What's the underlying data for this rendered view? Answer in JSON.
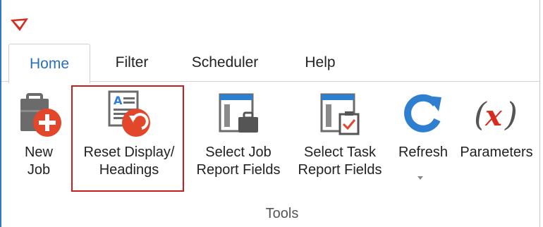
{
  "app": {
    "logo_icon": "app-logo-icon",
    "accent_color": "#c81e1e"
  },
  "tabs": [
    {
      "label": "Home",
      "active": true
    },
    {
      "label": "Filter",
      "active": false
    },
    {
      "label": "Scheduler",
      "active": false
    },
    {
      "label": "Help",
      "active": false
    }
  ],
  "ribbon": {
    "group_label": "Tools",
    "buttons": [
      {
        "line1": "New",
        "line2": "Job",
        "icon": "new-job-icon"
      },
      {
        "line1": "Reset Display/",
        "line2": "Headings",
        "icon": "reset-display-icon",
        "highlighted": true
      },
      {
        "line1": "Select Job",
        "line2": "Report Fields",
        "icon": "select-job-report-fields-icon"
      },
      {
        "line1": "Select Task",
        "line2": "Report Fields",
        "icon": "select-task-report-fields-icon"
      },
      {
        "line1": "Refresh",
        "line2": "",
        "icon": "refresh-icon",
        "has_dropdown": true
      },
      {
        "line1": "Parameters",
        "line2": "",
        "icon": "parameters-icon"
      }
    ]
  },
  "colors": {
    "tab_active": "#2b6fb8",
    "icon_blue": "#2f7fd0",
    "icon_red": "#e2472b",
    "highlight": "#c81e1e"
  }
}
